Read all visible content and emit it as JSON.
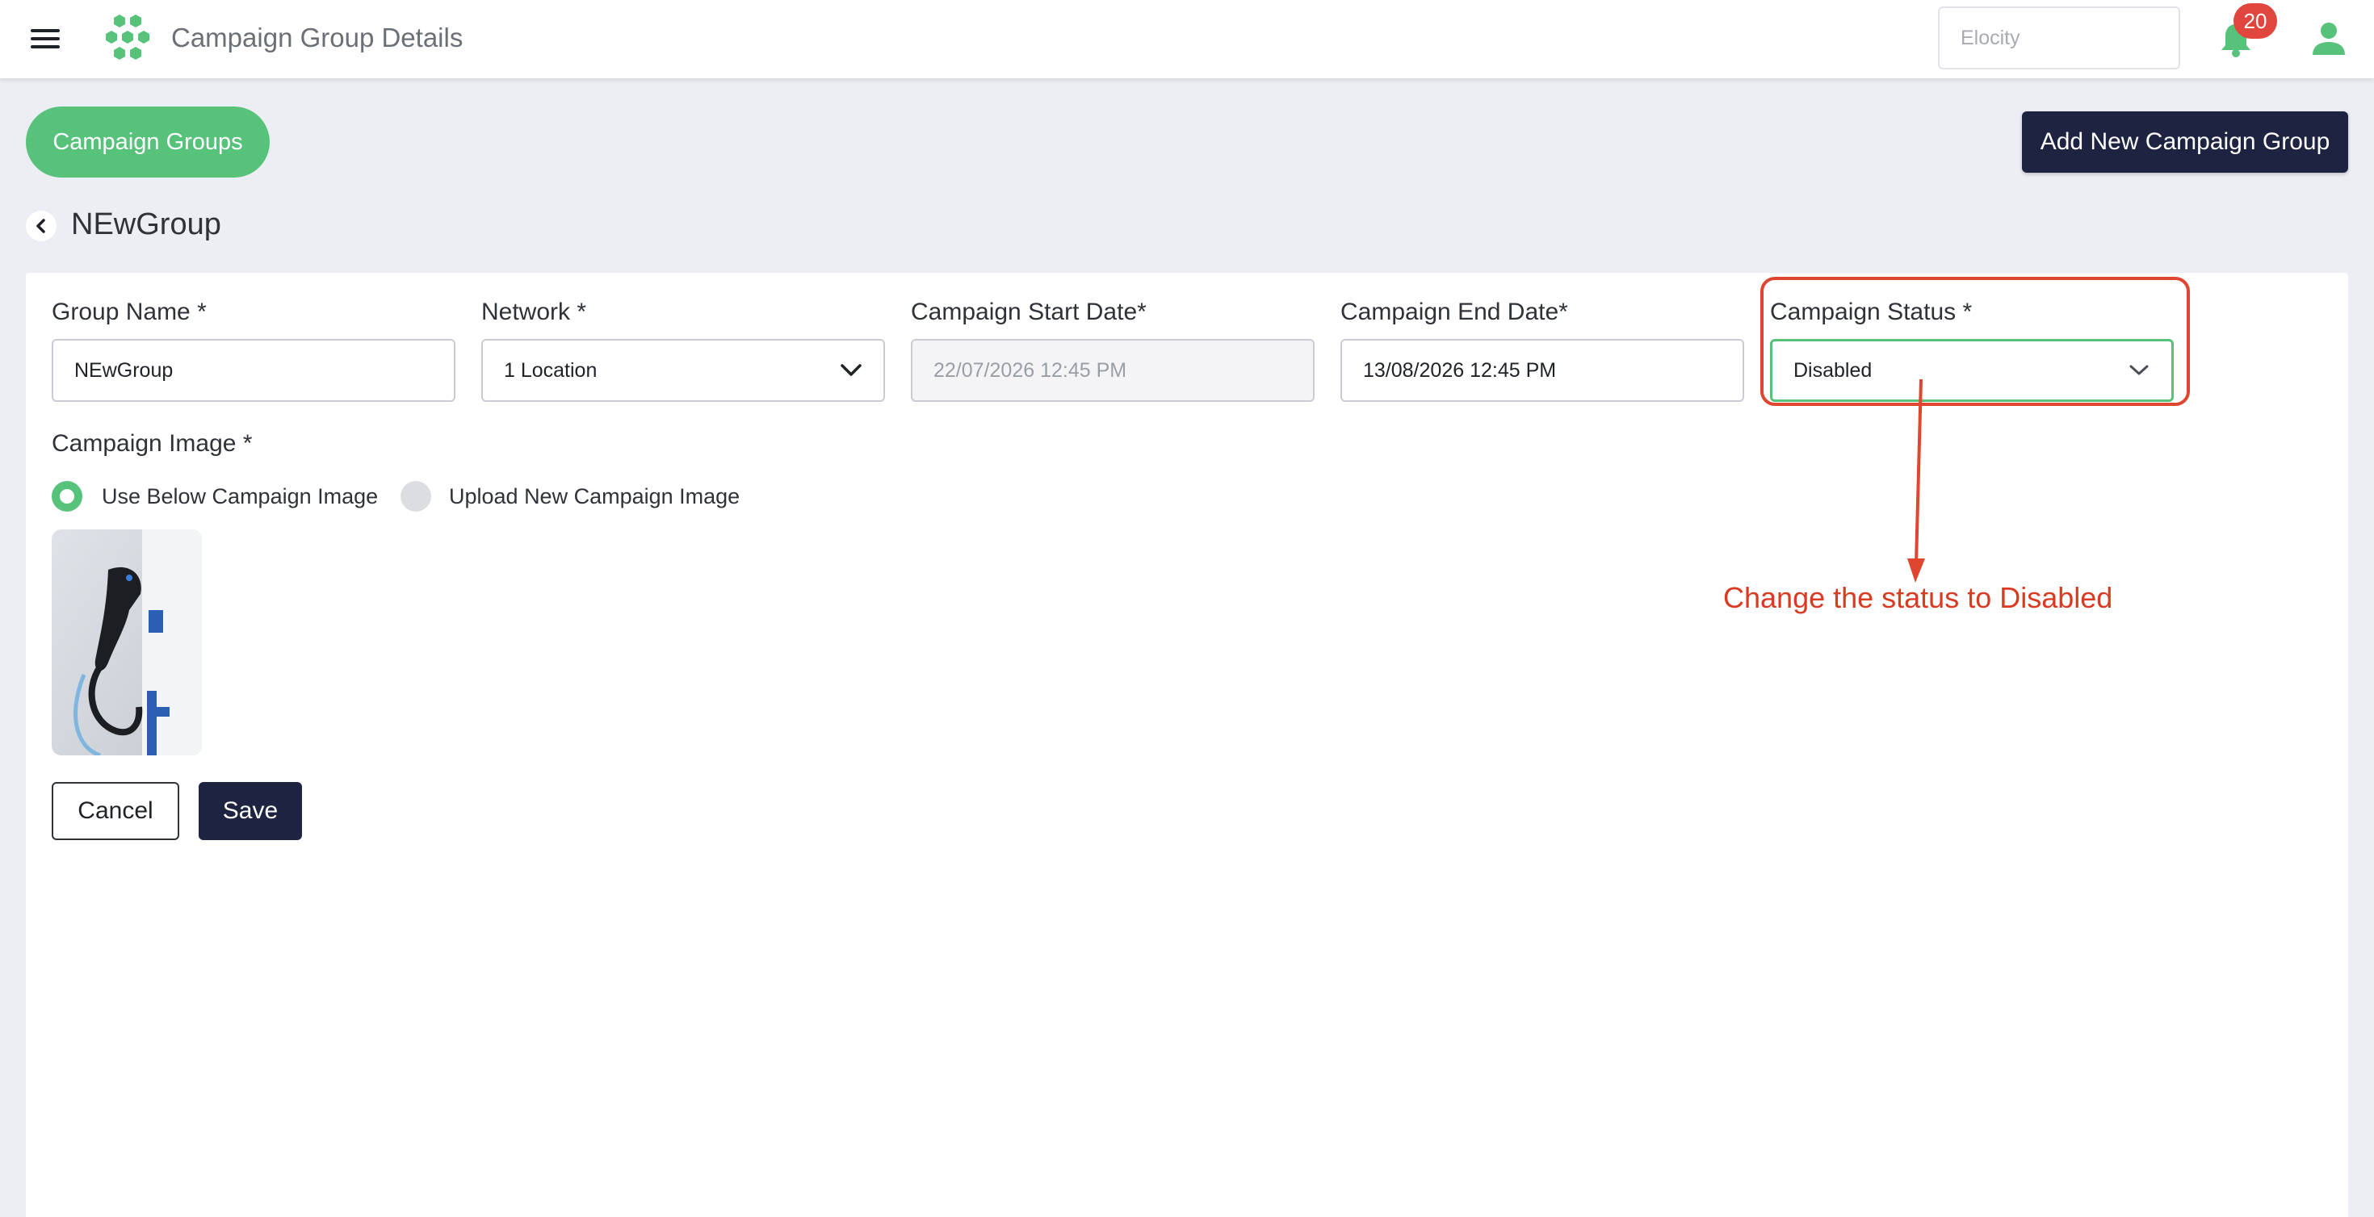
{
  "topbar": {
    "title": "Campaign Group Details",
    "search_placeholder": "Elocity",
    "notification_count": "20"
  },
  "header": {
    "campaign_groups_button": "Campaign Groups",
    "add_group_button": "Add New Campaign Group",
    "group_title": "NEwGroup"
  },
  "form": {
    "group_name_label": "Group Name *",
    "group_name_value": "NEwGroup",
    "network_label": "Network *",
    "network_value": "1 Location",
    "start_date_label": "Campaign Start Date*",
    "start_date_value": "22/07/2026 12:45 PM",
    "end_date_label": "Campaign End Date*",
    "end_date_value": "13/08/2026 12:45 PM",
    "status_label": "Campaign Status *",
    "status_value": "Disabled",
    "image_label": "Campaign Image *",
    "radio_use_existing": "Use Below Campaign Image",
    "radio_upload_new": "Upload New Campaign Image",
    "cancel_button": "Cancel",
    "save_button": "Save"
  },
  "annotation": {
    "text": "Change the status to Disabled",
    "color": "#d93a22"
  },
  "colors": {
    "brand_green": "#57c27a",
    "navy": "#1d2340",
    "badge_red": "#e0463d",
    "page_bg": "#eceef3"
  },
  "icons": {
    "menu": "hamburger-menu-icon",
    "logo": "hexagon-cluster-logo-icon",
    "bell": "bell-icon",
    "user": "user-icon",
    "back": "chevron-left-icon",
    "dropdown": "chevron-down-icon"
  }
}
